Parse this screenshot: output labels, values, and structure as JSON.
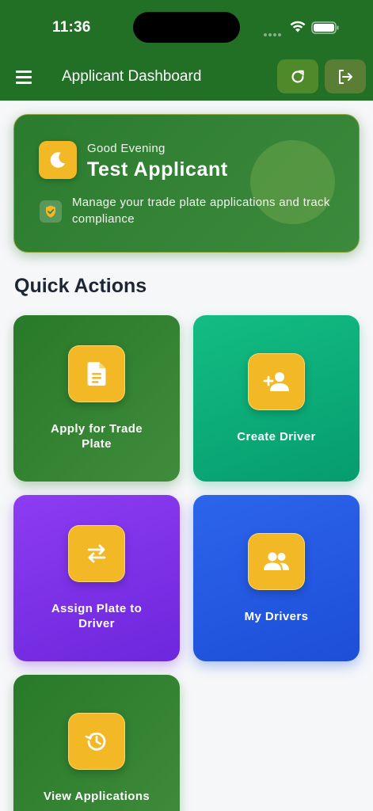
{
  "status_bar": {
    "time": "11:36"
  },
  "app_bar": {
    "title": "Applicant Dashboard",
    "menu_icon": "hamburger-menu-icon",
    "refresh_icon": "refresh-icon",
    "logout_icon": "logout-icon"
  },
  "greeting_card": {
    "greeting": "Good Evening",
    "name": "Test Applicant",
    "message": "Manage your trade plate applications and track compliance",
    "icon": "moon-icon",
    "badge_icon": "shield-check-icon"
  },
  "quick_actions": {
    "title": "Quick Actions",
    "items": [
      {
        "label": "Apply for Trade Plate",
        "icon": "document-icon",
        "color": "#287928"
      },
      {
        "label": "Create Driver",
        "icon": "add-person-icon",
        "color": "#10b981"
      },
      {
        "label": "Assign Plate to Driver",
        "icon": "swap-arrows-icon",
        "color": "#7c3aed"
      },
      {
        "label": "My Drivers",
        "icon": "people-icon",
        "color": "#2563eb"
      },
      {
        "label": "View Applications",
        "icon": "history-icon",
        "color": "#287928"
      }
    ]
  },
  "colors": {
    "primary": "#226f26",
    "accent": "#f2b825",
    "background": "#f6f7f9"
  }
}
